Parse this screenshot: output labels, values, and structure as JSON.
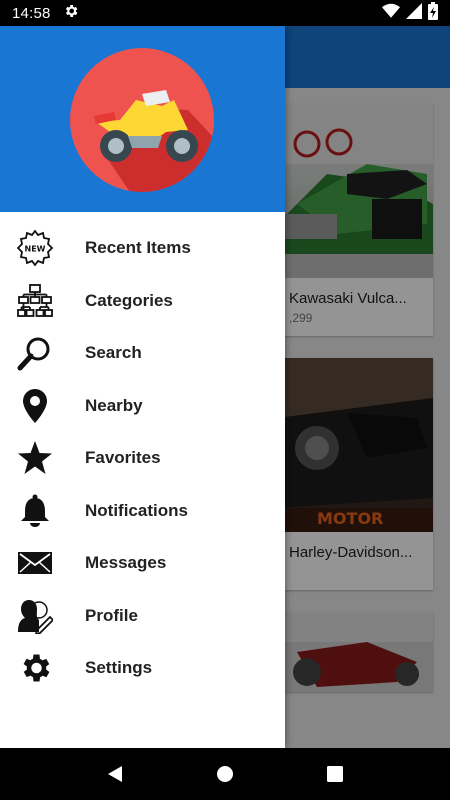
{
  "status_bar": {
    "time": "14:58",
    "settings_icon": "gear-icon",
    "wifi_icon": "wifi-icon",
    "signal_icon": "signal-icon",
    "battery_icon": "battery-charging-icon"
  },
  "background": {
    "cards": [
      {
        "title": "Kawasaki Vulca...",
        "price": ",299"
      },
      {
        "title": "Harley-Davidson...",
        "price": ""
      },
      {
        "title": "",
        "price": ""
      }
    ],
    "sign_text": "MOTOR"
  },
  "drawer": {
    "logo_icon": "motorcycle-logo-icon",
    "menu": [
      {
        "label": "Recent Items",
        "icon": "new-badge-icon"
      },
      {
        "label": "Categories",
        "icon": "sitemap-icon"
      },
      {
        "label": "Search",
        "icon": "search-icon"
      },
      {
        "label": "Nearby",
        "icon": "location-pin-icon"
      },
      {
        "label": "Favorites",
        "icon": "star-icon"
      },
      {
        "label": "Notifications",
        "icon": "bell-icon"
      },
      {
        "label": "Messages",
        "icon": "envelope-icon"
      },
      {
        "label": "Profile",
        "icon": "profile-edit-icon"
      },
      {
        "label": "Settings",
        "icon": "gear-icon"
      }
    ]
  },
  "nav_bar": {
    "back_icon": "back-triangle-icon",
    "home_icon": "home-circle-icon",
    "recents_icon": "recents-square-icon"
  },
  "colors": {
    "primary": "#1976d2",
    "logo_circle": "#ef5350",
    "logo_shadow": "#c62828",
    "bike_body": "#fdd835"
  }
}
